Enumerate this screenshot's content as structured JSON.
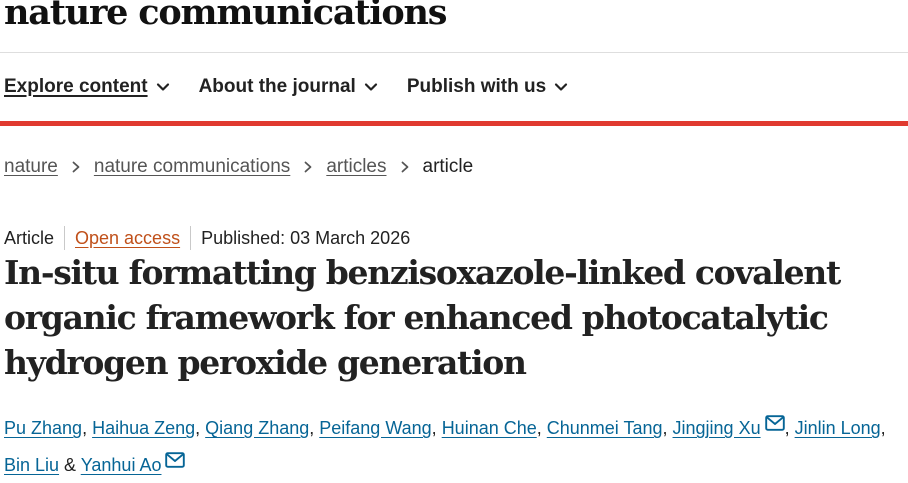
{
  "site": {
    "logo_text": "nature communications"
  },
  "nav": {
    "items": [
      {
        "label": "Explore content",
        "icon": "chevron-down-icon"
      },
      {
        "label": "About the journal",
        "icon": "chevron-down-icon"
      },
      {
        "label": "Publish with us",
        "icon": "chevron-down-icon"
      }
    ]
  },
  "breadcrumb": {
    "items": [
      "nature",
      "nature communications",
      "articles",
      "article"
    ],
    "separator_icon": "chevron-right-icon"
  },
  "article": {
    "type": "Article",
    "access": "Open access",
    "published": "Published: 03 March 2026",
    "title": "In-situ formatting benzisoxazole-linked covalent organic framework for enhanced photocatalytic hydrogen peroxide generation",
    "authors": [
      "Pu Zhang",
      "Haihua Zeng",
      "Qiang Zhang",
      "Peifang Wang",
      "Huinan Che",
      "Chunmei Tang",
      "Jingjing Xu",
      "Jinlin Long",
      "Bin Liu",
      "Yanhui Ao"
    ],
    "author_sep": ", ",
    "final_sep": " & ",
    "corresponding_icon": "mail-icon"
  },
  "colors": {
    "accent_red": "#e03a2f",
    "link_blue": "#066596",
    "open_access_orange": "#c0501a",
    "breadcrumb_gray": "#555555"
  }
}
